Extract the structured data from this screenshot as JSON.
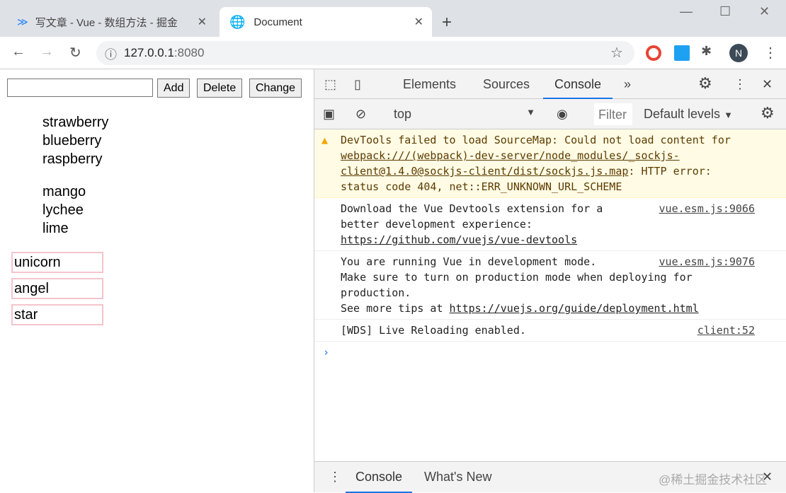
{
  "browser": {
    "tabs": [
      {
        "title": "写文章 - Vue - 数组方法 - 掘金",
        "icon": "juejin-icon"
      },
      {
        "title": "Document",
        "icon": "globe-icon",
        "active": true
      }
    ],
    "url_host": "127.0.0.1",
    "url_port": ":8080",
    "profile_initial": "N"
  },
  "page": {
    "input_value": "",
    "buttons": [
      "Add",
      "Delete",
      "Change"
    ],
    "list1": [
      "strawberry",
      "blueberry",
      "raspberry"
    ],
    "list2": [
      "mango",
      "lychee",
      "lime"
    ],
    "boxes": [
      "unicorn",
      "angel",
      "star"
    ]
  },
  "devtools": {
    "tabs": [
      "Elements",
      "Sources",
      "Console"
    ],
    "active_tab": "Console",
    "context": "top",
    "filter_placeholder": "Filter",
    "levels": "Default levels",
    "messages": [
      {
        "type": "warning",
        "pre": "DevTools failed to load SourceMap: Could not load content for ",
        "link": "webpack:///(webpack)-dev-server/node_modules/_sockjs-client@1.4.0@sockjs-client/dist/sockjs.js.map",
        "post": ": HTTP error: status code 404, net::ERR_UNKNOWN_URL_SCHEME"
      },
      {
        "type": "log",
        "text": "Download the Vue Devtools extension for a\nbetter development experience:\n",
        "link": "https://github.com/vuejs/vue-devtools",
        "source": "vue.esm.js:9066"
      },
      {
        "type": "log",
        "text": "You are running Vue in development mode.\nMake sure to turn on production mode when deploying for\nproduction.\nSee more tips at ",
        "link": "https://vuejs.org/guide/deployment.html",
        "source": "vue.esm.js:9076"
      },
      {
        "type": "log",
        "text": "[WDS] Live Reloading enabled.",
        "source": "client:52"
      }
    ],
    "drawer_tabs": [
      "Console",
      "What's New"
    ],
    "watermark": "@稀土掘金技术社区"
  }
}
